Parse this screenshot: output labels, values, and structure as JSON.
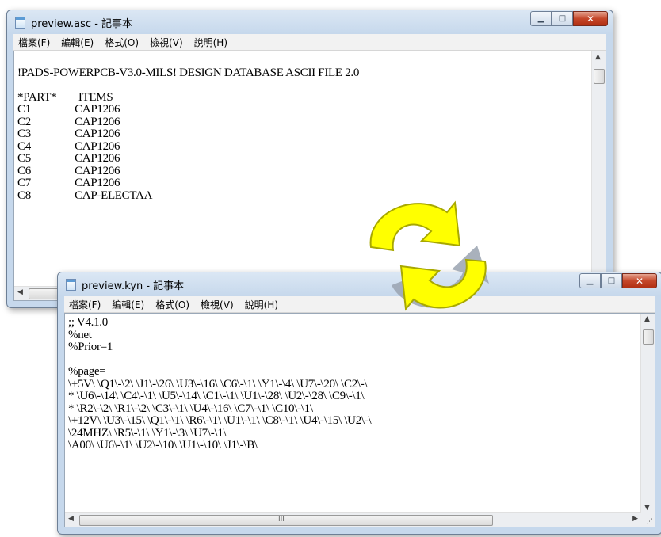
{
  "menu": [
    "檔案(F)",
    "編輯(E)",
    "格式(O)",
    "檢視(V)",
    "說明(H)"
  ],
  "windows": {
    "asc": {
      "title": "preview.asc - 記事本",
      "content": "\n!PADS-POWERPCB-V3.0-MILS! DESIGN DATABASE ASCII FILE 2.0\n\n*PART*        ITEMS\nC1                CAP1206\nC2                CAP1206\nC3                CAP1206\nC4                CAP1206\nC5                CAP1206\nC6                CAP1206\nC7                CAP1206\nC8                CAP-ELECTAA"
    },
    "kyn": {
      "title": "preview.kyn - 記事本",
      "content": ";; V4.1.0\n%net\n%Prior=1\n\n%page=\n\\+5V\\ \\Q1\\-\\2\\ \\J1\\-\\26\\ \\U3\\-\\16\\ \\C6\\-\\1\\ \\Y1\\-\\4\\ \\U7\\-\\20\\ \\C2\\-\\\n* \\U6\\-\\14\\ \\C4\\-\\1\\ \\U5\\-\\14\\ \\C1\\-\\1\\ \\U1\\-\\28\\ \\U2\\-\\28\\ \\C9\\-\\1\\\n* \\R2\\-\\2\\ \\R1\\-\\2\\ \\C3\\-\\1\\ \\U4\\-\\16\\ \\C7\\-\\1\\ \\C10\\-\\1\\\n\\+12V\\ \\U3\\-\\15\\ \\Q1\\-\\1\\ \\R6\\-\\1\\ \\U1\\-\\1\\ \\C8\\-\\1\\ \\U4\\-\\15\\ \\U2\\-\\\n\\24MHZ\\ \\R5\\-\\1\\ \\Y1\\-\\3\\ \\U7\\-\\1\\\n\\A00\\ \\U6\\-\\1\\ \\U2\\-\\10\\ \\U1\\-\\10\\ \\J1\\-\\B\\"
    }
  },
  "hscroll_grip": "III",
  "colors": {
    "arrow_fill": "#ffff00",
    "arrow_stroke": "#a8a800",
    "arrow_shadow": "#9aa3b0"
  }
}
